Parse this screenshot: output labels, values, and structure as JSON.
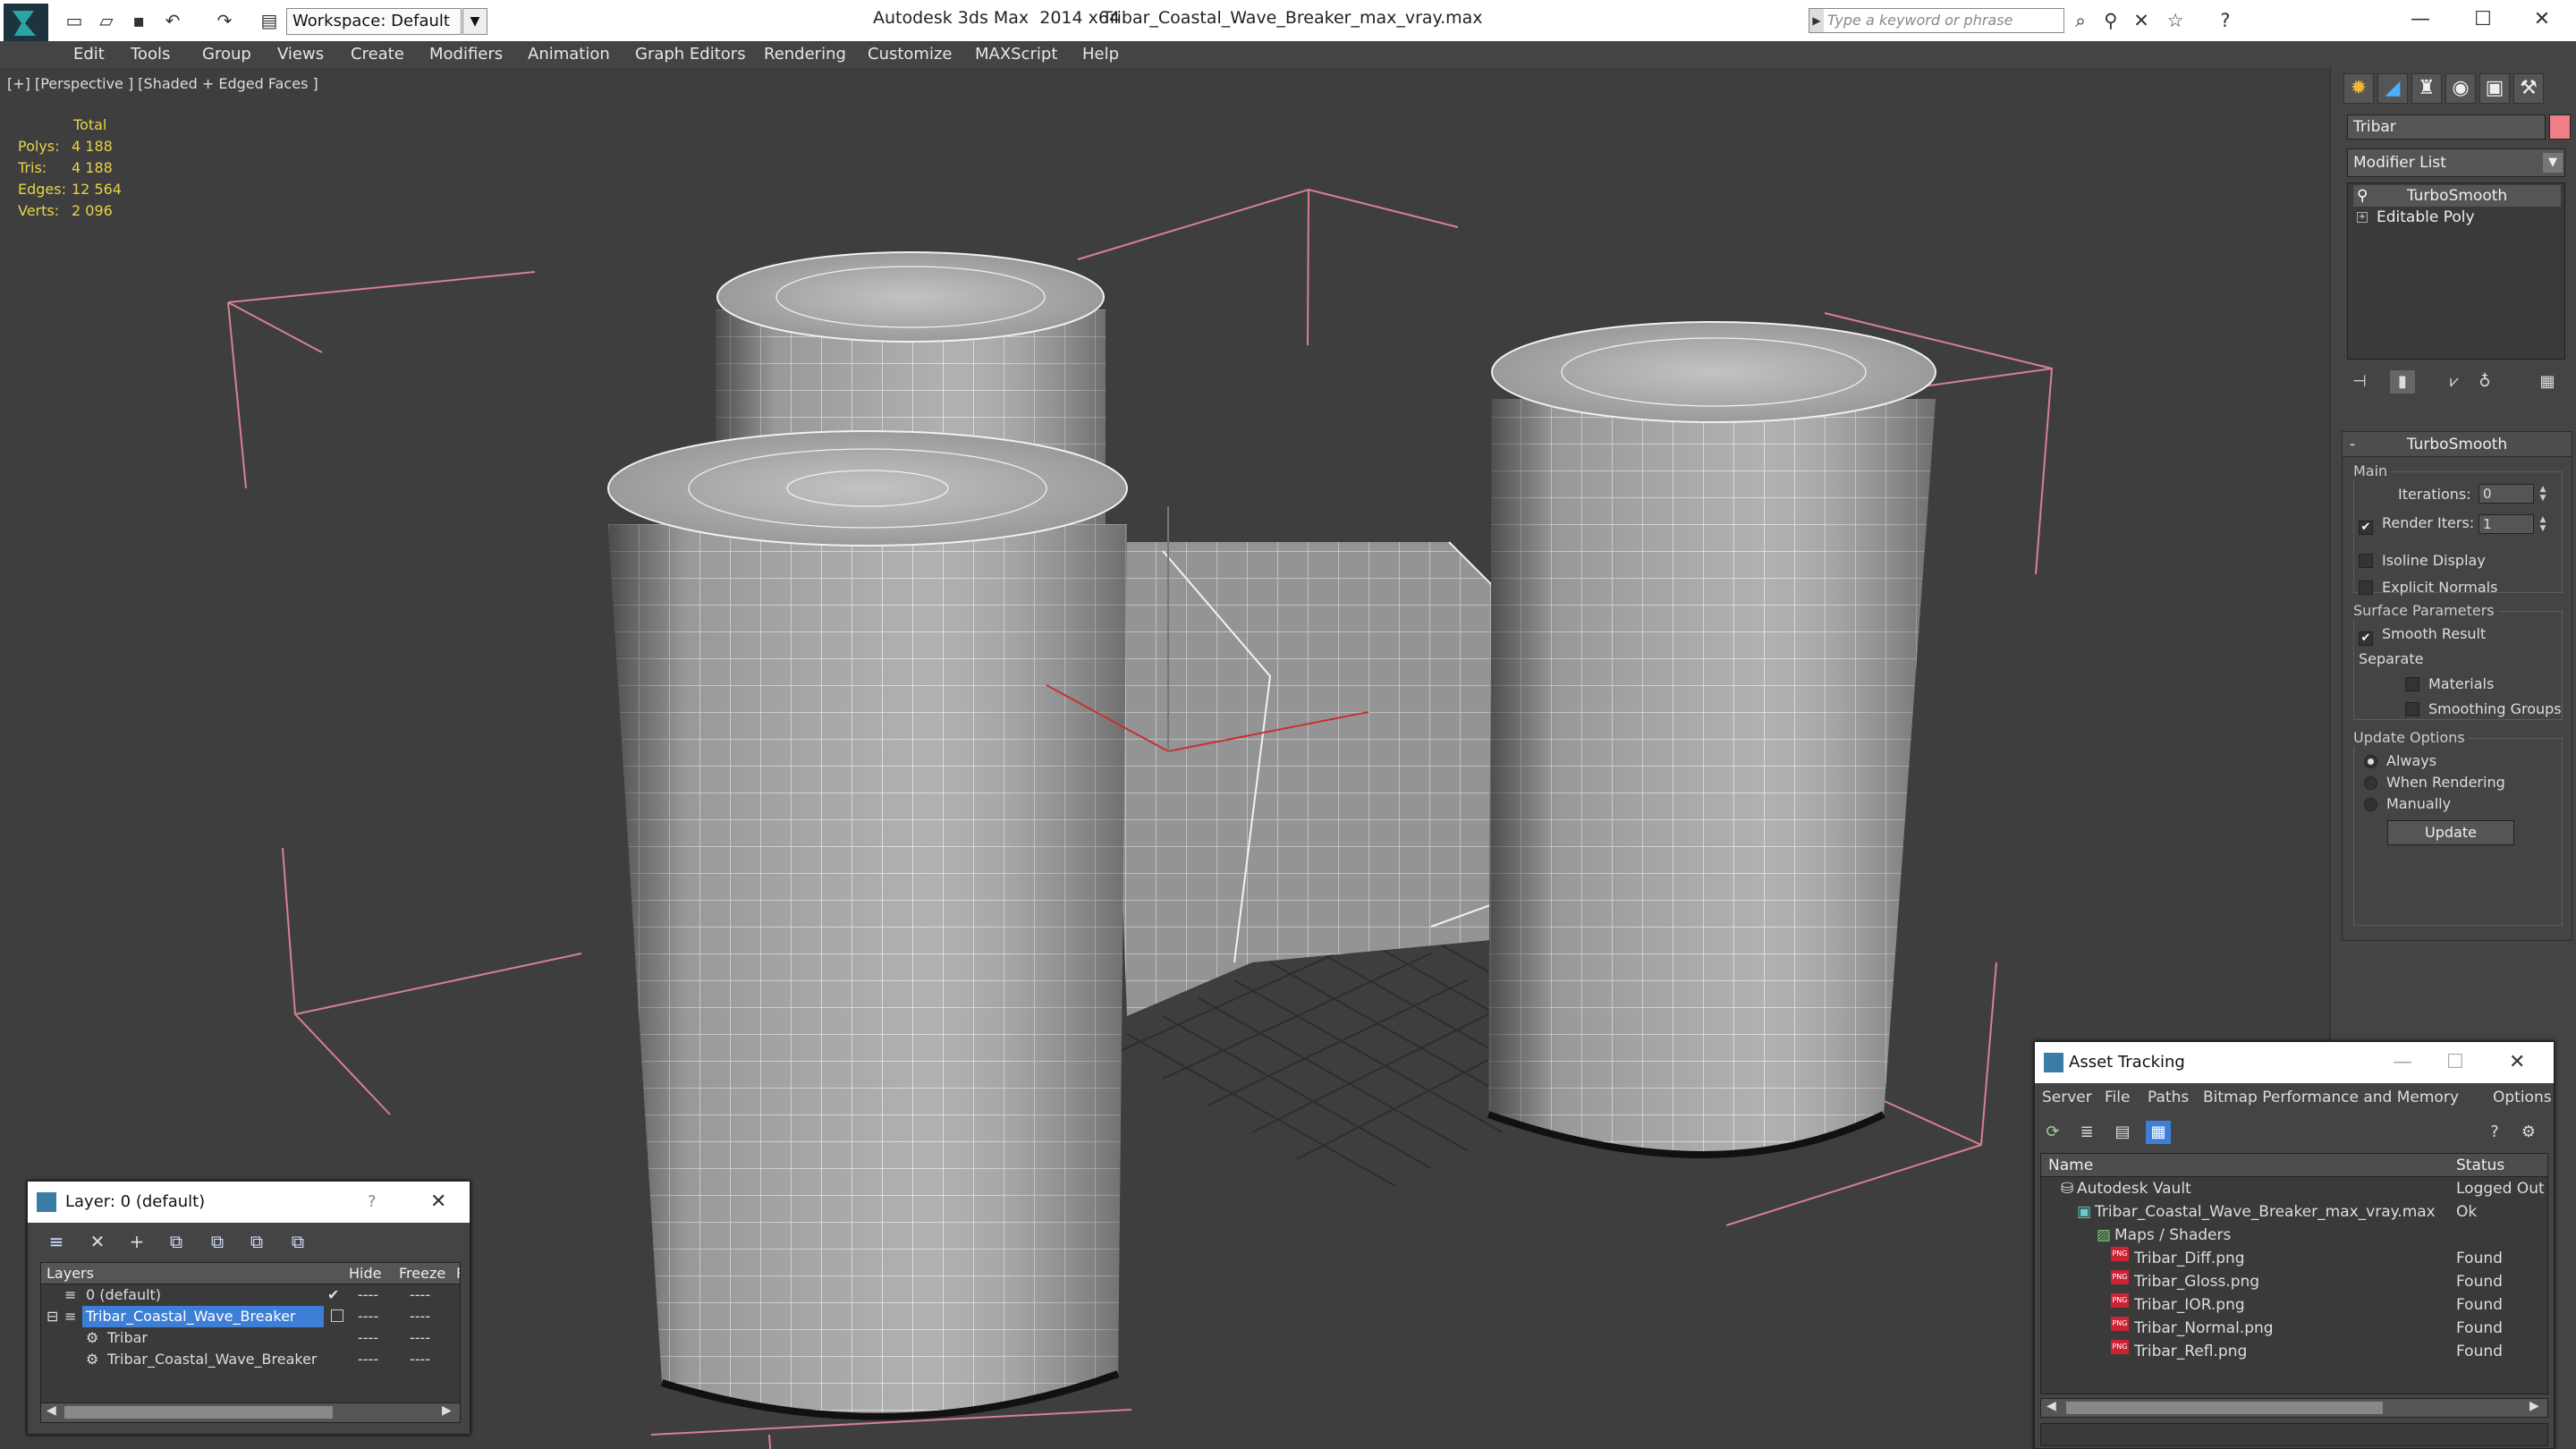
{
  "titlebar": {
    "workspace": "Workspace: Default",
    "app_title": "Autodesk 3ds Max  2014 x64",
    "file_title": "Tribar_Coastal_Wave_Breaker_max_vray.max",
    "search_placeholder": "Type a keyword or phrase"
  },
  "menu": [
    "Edit",
    "Tools",
    "Group",
    "Views",
    "Create",
    "Modifiers",
    "Animation",
    "Graph Editors",
    "Rendering",
    "Customize",
    "MAXScript",
    "Help"
  ],
  "viewport": {
    "label": "[+] [Perspective ] [Shaded + Edged Faces ]",
    "stats": {
      "header": "Total",
      "polys_label": "Polys:",
      "polys": "4 188",
      "tris_label": "Tris:",
      "tris": "4 188",
      "edges_label": "Edges:",
      "edges": "12 564",
      "verts_label": "Verts:",
      "verts": "2 096"
    }
  },
  "command_panel": {
    "object_name": "Tribar",
    "object_color": "#f07f8a",
    "modifier_list": "Modifier List",
    "stack": [
      "TurboSmooth",
      "Editable Poly"
    ],
    "rollout": {
      "title": "TurboSmooth",
      "main_label": "Main",
      "iterations_label": "Iterations:",
      "iterations": "0",
      "render_iters_label": "Render Iters:",
      "render_iters": "1",
      "render_iters_checked": true,
      "isoline_label": "Isoline Display",
      "explicit_normals_label": "Explicit Normals",
      "surface_params_label": "Surface Parameters",
      "smooth_result_label": "Smooth Result",
      "separate_label": "Separate",
      "materials_label": "Materials",
      "smoothing_groups_label": "Smoothing Groups",
      "update_options_label": "Update Options",
      "always_label": "Always",
      "when_rendering_label": "When Rendering",
      "manually_label": "Manually",
      "update_button": "Update"
    }
  },
  "layer_dialog": {
    "title": "Layer: 0 (default)",
    "help": "?",
    "columns": [
      "Layers",
      "Hide",
      "Freeze",
      "R"
    ],
    "rows": [
      {
        "name": "0 (default)",
        "hide": "----",
        "freeze": "----"
      },
      {
        "name": "Tribar_Coastal_Wave_Breaker",
        "hide": "----",
        "freeze": "----"
      },
      {
        "name": "Tribar",
        "hide": "----",
        "freeze": "----"
      },
      {
        "name": "Tribar_Coastal_Wave_Breaker",
        "hide": "----",
        "freeze": "----"
      }
    ]
  },
  "asset_tracking": {
    "title": "Asset Tracking",
    "menu": [
      "Server",
      "File",
      "Paths",
      "Bitmap Performance and Memory",
      "Options"
    ],
    "columns": [
      "Name",
      "Status"
    ],
    "rows": [
      {
        "name": "Autodesk Vault",
        "status": "Logged Out"
      },
      {
        "name": "Tribar_Coastal_Wave_Breaker_max_vray.max",
        "status": "Ok"
      },
      {
        "name": "Maps / Shaders",
        "status": ""
      },
      {
        "name": "Tribar_Diff.png",
        "status": "Found"
      },
      {
        "name": "Tribar_Gloss.png",
        "status": "Found"
      },
      {
        "name": "Tribar_IOR.png",
        "status": "Found"
      },
      {
        "name": "Tribar_Normal.png",
        "status": "Found"
      },
      {
        "name": "Tribar_Refl.png",
        "status": "Found"
      }
    ]
  }
}
